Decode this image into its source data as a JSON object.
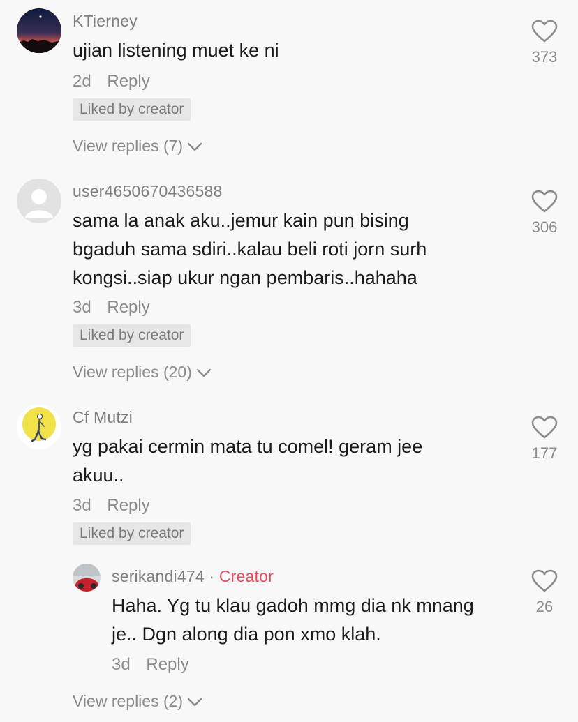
{
  "comments": [
    {
      "username": "KTierney",
      "text": "ujian listening muet ke ni",
      "time": "2d",
      "reply_label": "Reply",
      "badge": "Liked by creator",
      "view_replies": "View replies (7)",
      "likes": "373"
    },
    {
      "username": "user4650670436588",
      "text_lines": [
        "sama la anak aku..jemur kain pun bising",
        "bgaduh sama sdiri..kalau beli roti jorn surh",
        "kongsi..siap ukur ngan pembaris..hahaha"
      ],
      "time": "3d",
      "reply_label": "Reply",
      "badge": "Liked by creator",
      "view_replies": "View replies (20)",
      "likes": "306"
    },
    {
      "username": "Cf Mutzi",
      "text_lines": [
        "yg pakai cermin mata tu comel! geram jee",
        "akuu.."
      ],
      "time": "3d",
      "reply_label": "Reply",
      "badge": "Liked by creator",
      "likes": "177",
      "reply": {
        "username": "serikandi474",
        "separator": "·",
        "creator_label": "Creator",
        "text_lines": [
          "Haha. Yg tu klau gadoh mmg dia nk mnang",
          "je.. Dgn along dia pon xmo klah."
        ],
        "time": "3d",
        "reply_label": "Reply",
        "likes": "26"
      },
      "view_replies": "View replies (2)"
    }
  ],
  "icons": {
    "like": "heart-outline-icon",
    "expand": "chevron-down-icon"
  },
  "colors": {
    "background": "#f8f8f8",
    "creator_accent": "#e34b5f",
    "badge_bg": "#e6e6e6",
    "muted_text": "#8a8a8a"
  }
}
